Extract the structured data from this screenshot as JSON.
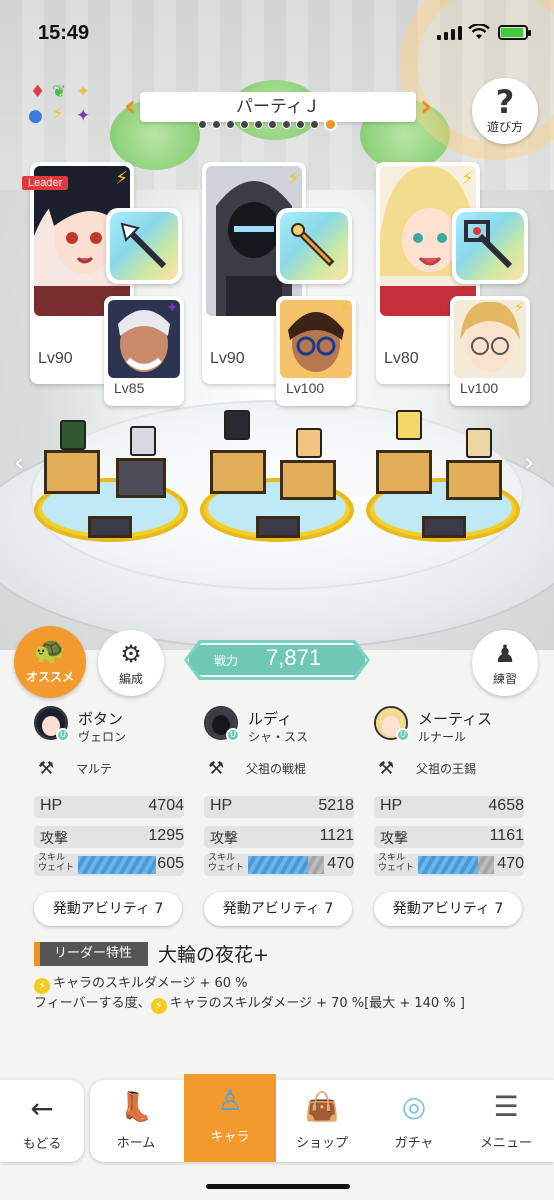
{
  "status_bar": {
    "time": "15:49"
  },
  "party": {
    "name": "パーティＪ",
    "page_count": 10,
    "active_page": 10
  },
  "help": {
    "label": "遊び方"
  },
  "leader_tag": "Leader",
  "cards": [
    {
      "lv": "Lv90",
      "sub_lv": "Lv85"
    },
    {
      "lv": "Lv90",
      "sub_lv": "Lv100"
    },
    {
      "lv": "Lv80",
      "sub_lv": "Lv100"
    }
  ],
  "buttons": {
    "osusume": "オススメ",
    "hensei": "編成",
    "renshu": "練習"
  },
  "power": {
    "label": "戦力",
    "value": "7,871"
  },
  "characters": [
    {
      "name": "ボタン",
      "nick": "ヴェロン",
      "weapon": "マルテ",
      "hp": "4704",
      "atk": "1295",
      "skill_wait": "605",
      "ability": "発動アビリティ 7"
    },
    {
      "name": "ルディ",
      "nick": "シャ・スス",
      "weapon": "父祖の戦棍",
      "hp": "5218",
      "atk": "1121",
      "skill_wait": "470",
      "ability": "発動アビリティ 7"
    },
    {
      "name": "メーティス",
      "nick": "ルナール",
      "weapon": "父祖の王錫",
      "hp": "4658",
      "atk": "1161",
      "skill_wait": "470",
      "ability": "発動アビリティ 7"
    }
  ],
  "stat_labels": {
    "hp": "HP",
    "atk": "攻撃",
    "skill": "スキル ウェイト"
  },
  "leader_trait": {
    "tag": "リーダー特性",
    "name": "大輪の夜花+",
    "line1": "キャラのスキルダメージ + 60 %",
    "line2_prefix": "フィーバーする度、",
    "line2": "キャラのスキルダメージ + 70 %[最大 + 140 % ]"
  },
  "nav": {
    "back": "もどる",
    "tabs": [
      "ホーム",
      "キャラ",
      "ショップ",
      "ガチャ",
      "メニュー"
    ],
    "active": "キャラ"
  },
  "colors": {
    "accent": "#f39a2e",
    "power": "#6fc8b6",
    "skill_bar": "#5aa8e0"
  }
}
